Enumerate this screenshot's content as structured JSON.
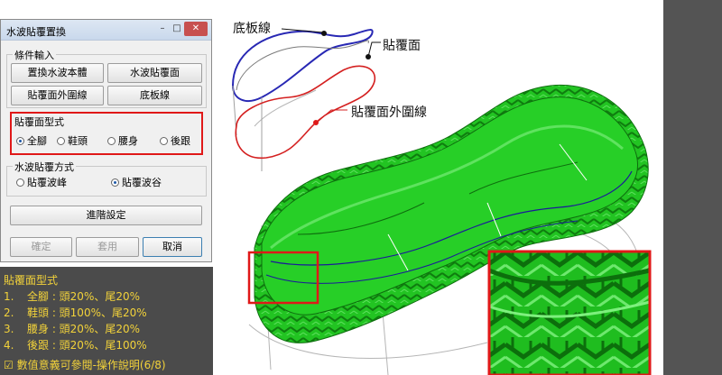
{
  "dialog": {
    "title": "水波貼覆置換",
    "window_buttons": {
      "minimize": "–",
      "maximize": "□",
      "close": "✕"
    },
    "conditions": {
      "label": "條件輸入",
      "buttons": [
        "置換水波本體",
        "水波貼覆面",
        "貼覆面外圍線",
        "底板線"
      ]
    },
    "coverage_type": {
      "label": "貼覆面型式",
      "options": [
        "全腳",
        "鞋頭",
        "腰身",
        "後跟"
      ],
      "selected": "全腳"
    },
    "wave_method": {
      "label": "水波貼覆方式",
      "options": [
        "貼覆波峰",
        "貼覆波谷"
      ],
      "selected": "貼覆波谷"
    },
    "advanced_button": "進階設定",
    "footer": {
      "ok": "確定",
      "apply": "套用",
      "cancel": "取消"
    }
  },
  "annotations": {
    "base_line": "底板線",
    "cover_surface": "貼覆面",
    "cover_outline": "貼覆面外圍線"
  },
  "notes": {
    "title": "貼覆面型式",
    "items": [
      {
        "num": "1.",
        "text": "全腳 : 頭20%、尾20%"
      },
      {
        "num": "2.",
        "text": "鞋頭 : 頭100%、尾20%"
      },
      {
        "num": "3.",
        "text": "腰身 : 頭20%、尾20%"
      },
      {
        "num": "4.",
        "text": "後跟 : 頭20%、尾100%"
      }
    ],
    "footer": "☑ 數值意義可參閱-操作說明(6/8)"
  },
  "colors": {
    "mesh_green": "#22c422",
    "mesh_dark": "#128a12",
    "highlight_red": "#e01818",
    "curve_blue": "#2828b4",
    "note_yellow": "#f2d23a"
  }
}
